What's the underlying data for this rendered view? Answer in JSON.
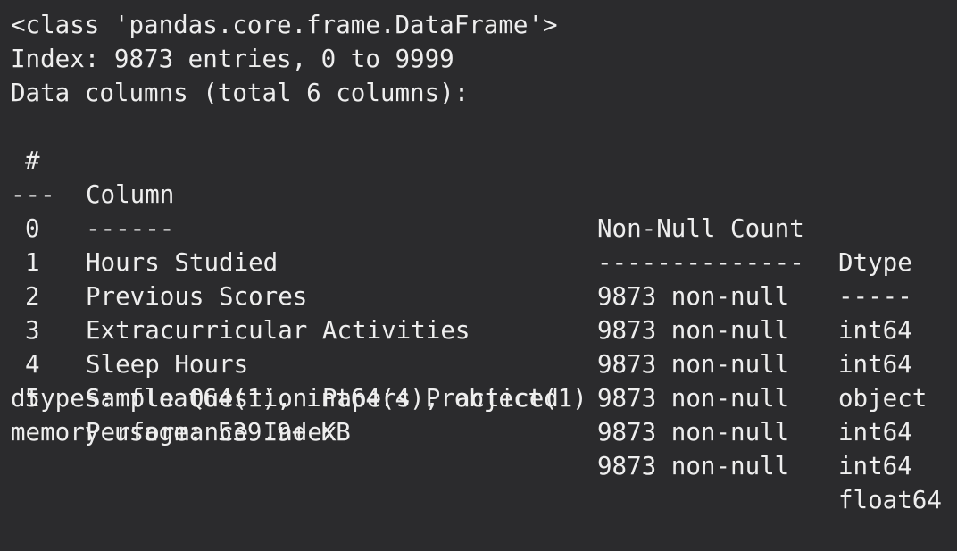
{
  "output": {
    "class_line": "<class 'pandas.core.frame.DataFrame'>",
    "index_line": "Index: 9873 entries, 0 to 9999",
    "data_columns_line": "Data columns (total 6 columns):",
    "header": {
      "index": "#",
      "column": "Column",
      "count": "Non-Null Count",
      "dtype": "Dtype"
    },
    "separator": {
      "index": "---",
      "column": "------",
      "count": "--------------",
      "dtype": "-----"
    },
    "rows": [
      {
        "index": "0",
        "column": "Hours Studied",
        "count": "9873 non-null",
        "dtype": "int64"
      },
      {
        "index": "1",
        "column": "Previous Scores",
        "count": "9873 non-null",
        "dtype": "int64"
      },
      {
        "index": "2",
        "column": "Extracurricular Activities",
        "count": "9873 non-null",
        "dtype": "object"
      },
      {
        "index": "3",
        "column": "Sleep Hours",
        "count": "9873 non-null",
        "dtype": "int64"
      },
      {
        "index": "4",
        "column": "Sample Question Papers Practiced",
        "count": "9873 non-null",
        "dtype": "int64"
      },
      {
        "index": "5",
        "column": "Performance Index",
        "count": "9873 non-null",
        "dtype": "float64"
      }
    ],
    "dtypes_line": "dtypes: float64(1), int64(4), object(1)",
    "memory_line": "memory usage: 539.9+ KB"
  }
}
